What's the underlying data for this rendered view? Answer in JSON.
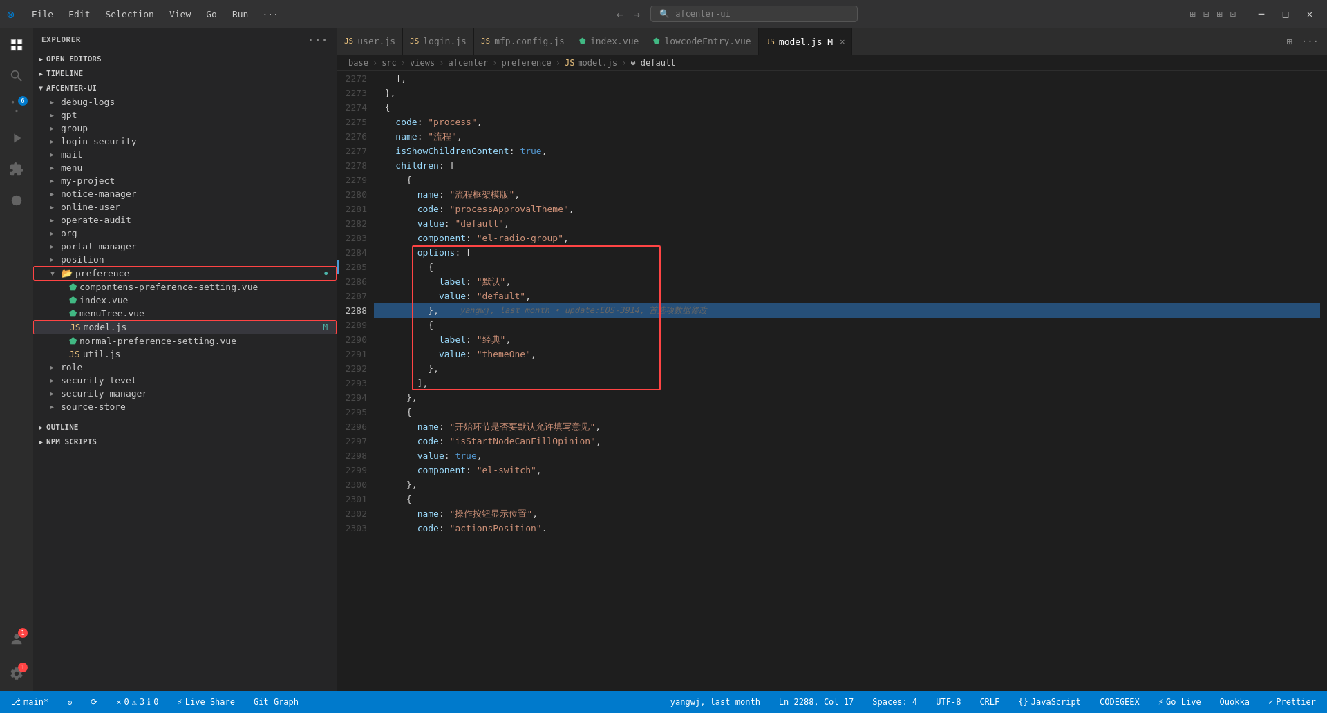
{
  "titlebar": {
    "logo": "VS",
    "menu": [
      "File",
      "Edit",
      "Selection",
      "View",
      "Go",
      "Run",
      "..."
    ],
    "search_placeholder": "afcenter-ui",
    "nav_back": "←",
    "nav_forward": "→",
    "window_controls": [
      "_",
      "⬜",
      "✕"
    ]
  },
  "tabs": [
    {
      "id": "user-js",
      "label": "user.js",
      "type": "js",
      "active": false,
      "modified": false
    },
    {
      "id": "login-js",
      "label": "login.js",
      "type": "js",
      "active": false,
      "modified": false
    },
    {
      "id": "mfp-config-js",
      "label": "mfp.config.js",
      "type": "js",
      "active": false,
      "modified": false
    },
    {
      "id": "index-vue",
      "label": "index.vue",
      "type": "vue",
      "active": false,
      "modified": false
    },
    {
      "id": "lowcodeEntry-vue",
      "label": "lowcodeEntry.vue",
      "type": "vue",
      "active": false,
      "modified": false
    },
    {
      "id": "model-js",
      "label": "model.js",
      "type": "js",
      "active": true,
      "modified": true
    }
  ],
  "breadcrumb": [
    "base",
    "src",
    "views",
    "afcenter",
    "preference",
    "model.js",
    "default"
  ],
  "sidebar": {
    "title": "EXPLORER",
    "sections": {
      "open_editors": "OPEN EDITORS",
      "timeline": "TIMELINE",
      "project": "AFCENTER-UI",
      "outline": "OUTLINE",
      "npm_scripts": "NPM SCRIPTS"
    },
    "tree_items": [
      "debug-logs",
      "gpt",
      "group",
      "login-security",
      "mail",
      "menu",
      "my-project",
      "notice-manager",
      "online-user",
      "operate-audit",
      "org",
      "portal-manager",
      "position",
      "preference",
      "role",
      "security-level",
      "security-manager",
      "source-store"
    ],
    "preference_children": [
      "compontens-preference-setting.vue",
      "index.vue",
      "menuTree.vue",
      "model.js",
      "normal-preference-setting.vue",
      "util.js"
    ]
  },
  "code_lines": [
    {
      "num": 2272,
      "content": "    ],"
    },
    {
      "num": 2273,
      "content": "  },"
    },
    {
      "num": 2274,
      "content": "  {"
    },
    {
      "num": 2275,
      "content": "    code: \"process\","
    },
    {
      "num": 2276,
      "content": "    name: \"流程\","
    },
    {
      "num": 2277,
      "content": "    isShowChildrenContent: true,"
    },
    {
      "num": 2278,
      "content": "    children: ["
    },
    {
      "num": 2279,
      "content": "      {"
    },
    {
      "num": 2280,
      "content": "        name: \"流程框架模版\","
    },
    {
      "num": 2281,
      "content": "        code: \"processApprovalTheme\","
    },
    {
      "num": 2282,
      "content": "        value: \"default\","
    },
    {
      "num": 2283,
      "content": "        component: \"el-radio-group\","
    },
    {
      "num": 2284,
      "content": "        options: ["
    },
    {
      "num": 2285,
      "content": "          {"
    },
    {
      "num": 2286,
      "content": "            label: \"默认\","
    },
    {
      "num": 2287,
      "content": "            value: \"default\","
    },
    {
      "num": 2288,
      "content": "          },"
    },
    {
      "num": 2289,
      "content": "          {"
    },
    {
      "num": 2290,
      "content": "            label: \"经典\","
    },
    {
      "num": 2291,
      "content": "            value: \"themeOne\","
    },
    {
      "num": 2292,
      "content": "          },"
    },
    {
      "num": 2293,
      "content": "        ],"
    },
    {
      "num": 2294,
      "content": "      },"
    },
    {
      "num": 2295,
      "content": "      {"
    },
    {
      "num": 2296,
      "content": "        name: \"开始环节是否要默认允许填写意见\","
    },
    {
      "num": 2297,
      "content": "        code: \"isStartNodeCanFillOpinion\","
    },
    {
      "num": 2298,
      "content": "        value: true,"
    },
    {
      "num": 2299,
      "content": "        component: \"el-switch\","
    },
    {
      "num": 2300,
      "content": "      },"
    },
    {
      "num": 2301,
      "content": "      {"
    },
    {
      "num": 2302,
      "content": "        name: \"操作按钮显示位置\","
    },
    {
      "num": 2303,
      "content": "        code: \"actionsPosition\"."
    }
  ],
  "git_blame": {
    "line": 2288,
    "author": "yangwj",
    "time": "last month",
    "message": "update:EOS-3914, 首选项数据修改"
  },
  "statusbar": {
    "branch": "main*",
    "sync": "↻",
    "remote": "⟳",
    "errors": "0",
    "warnings": "3",
    "info": "0",
    "live_share": "Live Share",
    "git_graph": "Git Graph",
    "position": "yangwj, last month",
    "cursor": "Ln 2288, Col 17",
    "spaces": "Spaces: 4",
    "encoding": "UTF-8",
    "eol": "CRLF",
    "language": "JavaScript",
    "codegeex": "CODEGEEX",
    "go_live": "Go Live",
    "quokka": "Quokka",
    "prettier": "Prettier"
  }
}
